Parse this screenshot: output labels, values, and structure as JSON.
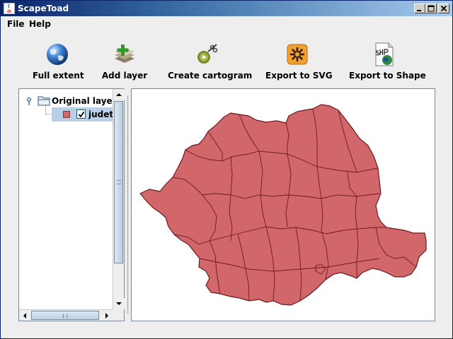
{
  "window": {
    "title": "ScapeToad"
  },
  "menu": {
    "file": "File",
    "help": "Help"
  },
  "toolbar": {
    "full_extent": {
      "label": "Full extent",
      "icon": "globe-icon"
    },
    "add_layer": {
      "label": "Add layer",
      "icon": "add-layer-icon"
    },
    "create_cartogram": {
      "label": "Create cartogram",
      "icon": "cartogram-icon"
    },
    "export_svg": {
      "label": "Export to SVG",
      "icon": "export-svg-icon"
    },
    "export_shape": {
      "label": "Export to Shape",
      "icon": "export-shape-icon"
    }
  },
  "layers": {
    "root_label": "Original layers",
    "items": [
      {
        "label": "judete",
        "checked": true,
        "color": "#d1676b"
      }
    ]
  },
  "map": {
    "fill_color": "#d1676b",
    "stroke_color": "#6b1a1e"
  }
}
